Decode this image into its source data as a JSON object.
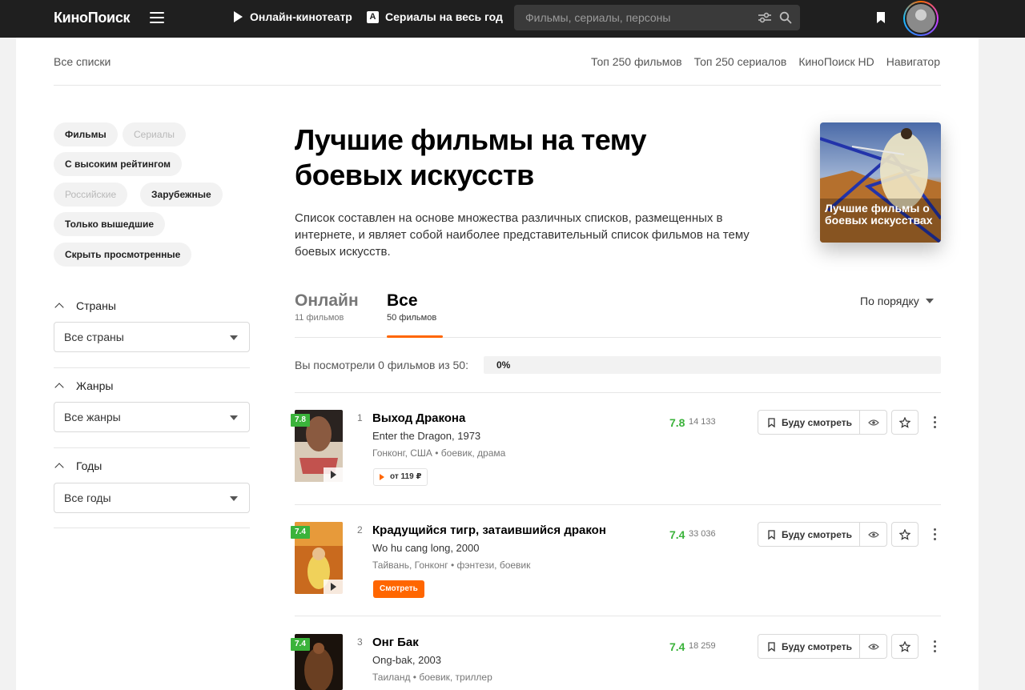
{
  "header": {
    "logo": "КиноПоиск",
    "nav_online": "Онлайн-кинотеатр",
    "nav_series_badge": "A",
    "nav_series": "Сериалы на весь год",
    "search_placeholder": "Фильмы, сериалы, персоны"
  },
  "subnav": {
    "all_lists": "Все списки",
    "links": [
      "Топ 250 фильмов",
      "Топ 250 сериалов",
      "КиноПоиск HD",
      "Навигатор"
    ]
  },
  "sidebar": {
    "chips": [
      "Фильмы",
      "Сериалы",
      "С высоким рейтингом",
      "Российские",
      "Зарубежные",
      "Только вышедшие",
      "Скрыть просмотренные"
    ],
    "countries": {
      "heading": "Страны",
      "value": "Все страны"
    },
    "genres": {
      "heading": "Жанры",
      "value": "Все жанры"
    },
    "years": {
      "heading": "Годы",
      "value": "Все годы"
    }
  },
  "hero": {
    "title": "Лучшие фильмы на тему боевых искусств",
    "description": "Список составлен на основе множества различных списков, размещенных в интернете, и являет собой наиболее представительный список фильмов на тему боевых искусств.",
    "cover_caption": "Лучшие фильмы о боевых искусствах"
  },
  "tabs": [
    {
      "label": "Онлайн",
      "count": "11 фильмов"
    },
    {
      "label": "Все",
      "count": "50 фильмов"
    }
  ],
  "sort_label": "По порядку",
  "progress": {
    "label": "Вы посмотрели 0 фильмов из 50:",
    "percent_text": "0%",
    "fraction": 0
  },
  "films": [
    {
      "position": "1",
      "badge": "7.8",
      "title": "Выход Дракона",
      "original": "Enter the Dragon, 1973",
      "meta": "Гонконг, США • боевик, драма",
      "rating": "7.8",
      "votes": "14 133",
      "action": "от 119 ₽",
      "action_type": "price"
    },
    {
      "position": "2",
      "badge": "7.4",
      "title": "Крадущийся тигр, затаившийся дракон",
      "original": "Wo hu cang long, 2000",
      "meta": "Тайвань, Гонконг • фэнтези, боевик",
      "rating": "7.4",
      "votes": "33 036",
      "action": "Смотреть",
      "action_type": "watch"
    },
    {
      "position": "3",
      "badge": "7.4",
      "title": "Онг Бак",
      "original": "Ong-bak, 2003",
      "meta": "Таиланд • боевик, триллер",
      "rating": "7.4",
      "votes": "18 259"
    }
  ],
  "want_button": "Буду смотреть",
  "colors": {
    "accent": "#ff6600",
    "rating_green": "#3bb33b",
    "header_bg": "#1f1f1f"
  }
}
